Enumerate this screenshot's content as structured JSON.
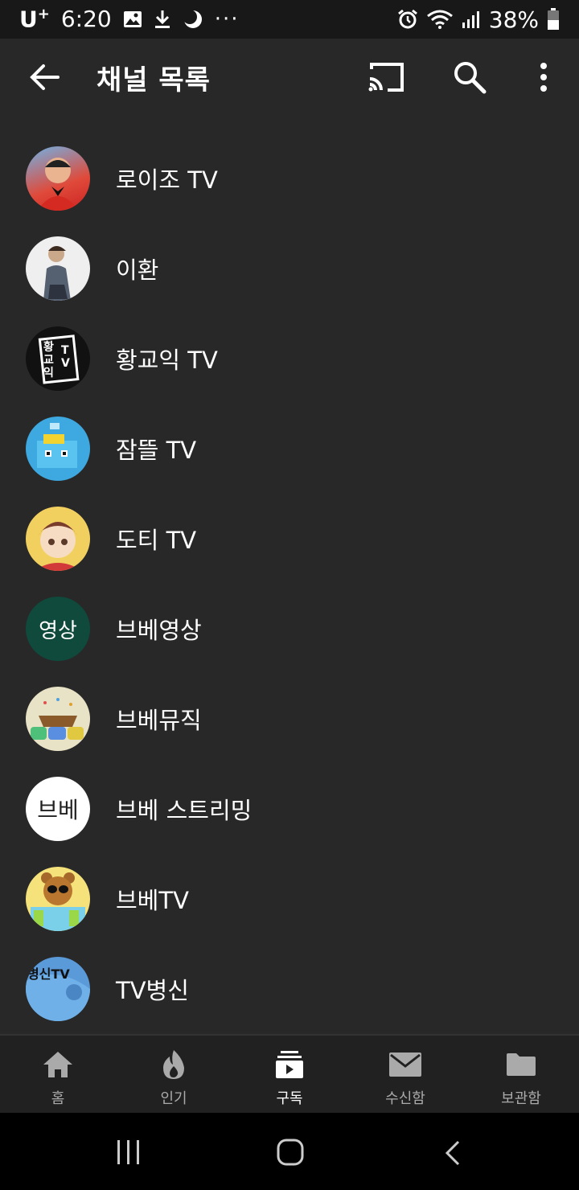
{
  "status_bar": {
    "carrier": "U",
    "carrier_sup": "+",
    "time": "6:20",
    "dots": "···",
    "battery": "38%"
  },
  "appbar": {
    "title": "채널 목록"
  },
  "channels": [
    {
      "name": "로이조 TV",
      "avatar_text": "",
      "avatar_color": "#d43a2f"
    },
    {
      "name": "이환",
      "avatar_text": "",
      "avatar_color": "#e8e8e8"
    },
    {
      "name": "황교익 TV",
      "avatar_text": "황교익",
      "avatar_sub": "TV",
      "avatar_color": "#111111"
    },
    {
      "name": "잠뜰 TV",
      "avatar_text": "",
      "avatar_color": "#49b6e8"
    },
    {
      "name": "도티 TV",
      "avatar_text": "",
      "avatar_color": "#f0c84a"
    },
    {
      "name": "브베영상",
      "avatar_text": "영상",
      "avatar_color": "#0f4a3c"
    },
    {
      "name": "브베뮤직",
      "avatar_text": "",
      "avatar_color": "#e6e0c4"
    },
    {
      "name": "브베 스트리밍",
      "avatar_text": "브베",
      "avatar_color": "#ffffff"
    },
    {
      "name": "브베TV",
      "avatar_text": "",
      "avatar_color": "#f6e27a"
    },
    {
      "name": "TV병신",
      "avatar_text": "병신TV",
      "avatar_color": "#5a9ad8"
    }
  ],
  "bottom_nav": [
    {
      "label": "홈",
      "icon": "home-icon"
    },
    {
      "label": "인기",
      "icon": "fire-icon"
    },
    {
      "label": "구독",
      "icon": "subscriptions-icon",
      "active": true
    },
    {
      "label": "수신함",
      "icon": "inbox-icon"
    },
    {
      "label": "보관함",
      "icon": "library-icon"
    }
  ]
}
